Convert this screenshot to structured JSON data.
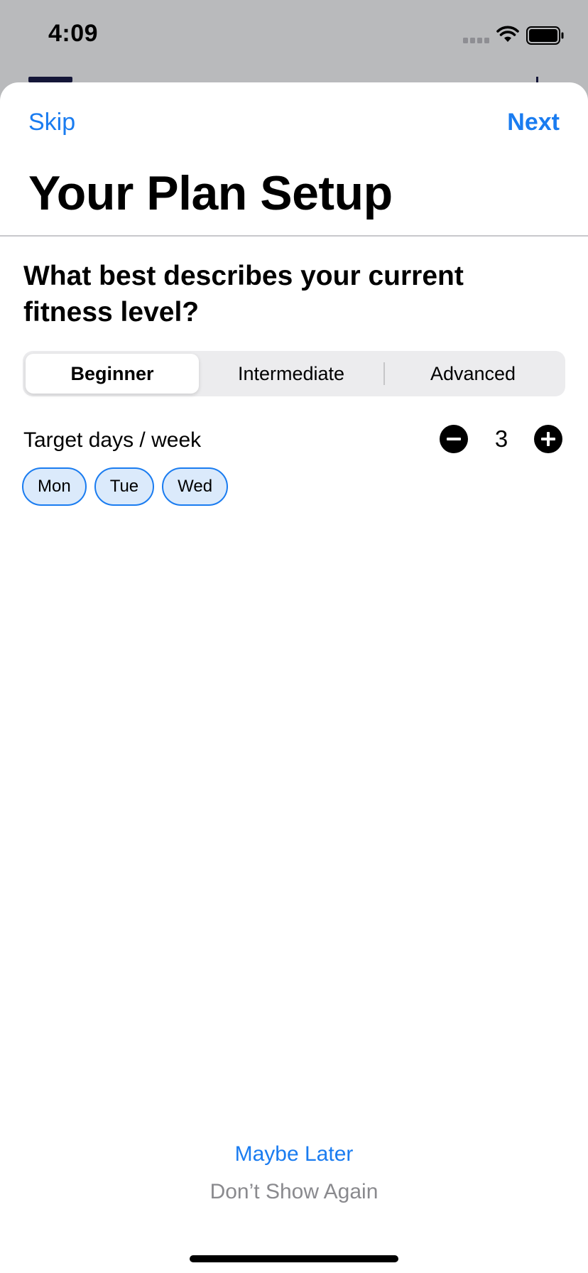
{
  "status_bar": {
    "time": "4:09",
    "icons": [
      "cellular-signal-icon",
      "wifi-icon",
      "battery-icon"
    ]
  },
  "nav": {
    "skip_label": "Skip",
    "next_label": "Next"
  },
  "title": "Your Plan Setup",
  "question": "What best describes your current fitness level?",
  "fitness_levels": {
    "options": [
      "Beginner",
      "Intermediate",
      "Advanced"
    ],
    "selected": "Beginner"
  },
  "target_days": {
    "label": "Target days / week",
    "value": "3",
    "days": [
      "Mon",
      "Tue",
      "Wed"
    ]
  },
  "footer": {
    "maybe_later": "Maybe Later",
    "dont_show_again": "Don’t Show Again"
  },
  "colors": {
    "accent": "#1a7cf0",
    "chip_fill": "#dbeafb",
    "secondary_text": "#8a8a8e"
  }
}
